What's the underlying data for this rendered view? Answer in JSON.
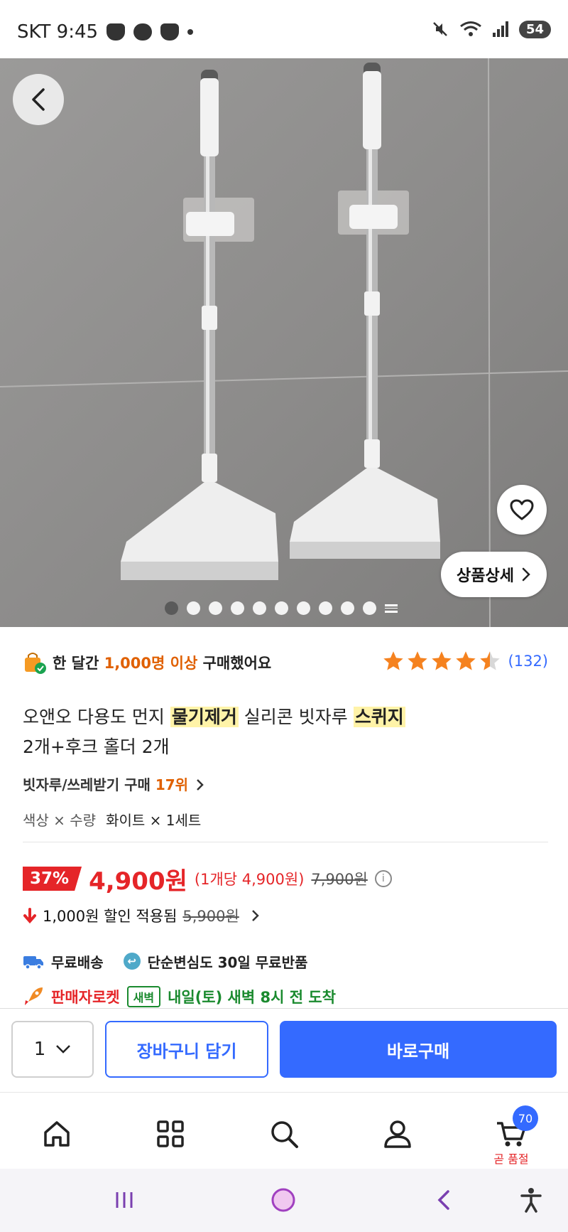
{
  "status_bar": {
    "carrier_time": "SKT 9:45",
    "battery": "54",
    "icons": [
      "coffee-icon",
      "chat-icon",
      "coffee-icon",
      "dot-icon",
      "mute-icon",
      "wifi-icon",
      "signal-icon"
    ]
  },
  "product_image": {
    "carousel_total": 11,
    "carousel_active": 0,
    "detail_label": "상품상세"
  },
  "purchase_info": {
    "prefix": "한 달간 ",
    "highlight": "1,000명 이상",
    "suffix": " 구매했어요",
    "rating": 4.5,
    "review_count": "(132)"
  },
  "title": {
    "part1": "오앤오 다용도 먼지 ",
    "mark1": "물기제거",
    "part2": " 실리콘 빗자루 ",
    "mark2": "스퀴지",
    "part3": "2개+후크 홀더 2개"
  },
  "rank": {
    "category": "빗자루/쓰레받기 구매 ",
    "position": "17위"
  },
  "option": {
    "label": "색상 × 수량",
    "value": "화이트 × 1세트"
  },
  "price": {
    "discount_rate": "37%",
    "sale_price": "4,900원",
    "unit_price": "(1개당 4,900원)",
    "original_price": "7,900원"
  },
  "discount": {
    "text": "1,000원 할인 적용됨",
    "before_price": "5,900원"
  },
  "shipping": {
    "free_shipping": "무료배송",
    "free_return": "단순변심도 30일 무료반품",
    "rocket_label": "판매자로켓",
    "dawn_badge": "새벽",
    "delivery_text": "내일(토) 새벽 8시 전 도착"
  },
  "buy_bar": {
    "quantity": "1",
    "cart_button": "장바구니 담기",
    "buy_button": "바로구매"
  },
  "bottom_nav": {
    "cart_badge": "70",
    "cart_label": "곧 품절"
  },
  "colors": {
    "accent_blue": "#346aff",
    "price_red": "#e52528",
    "highlight_orange": "#e06000",
    "star_orange": "#f5821f",
    "delivery_green": "#1a8a2e"
  }
}
